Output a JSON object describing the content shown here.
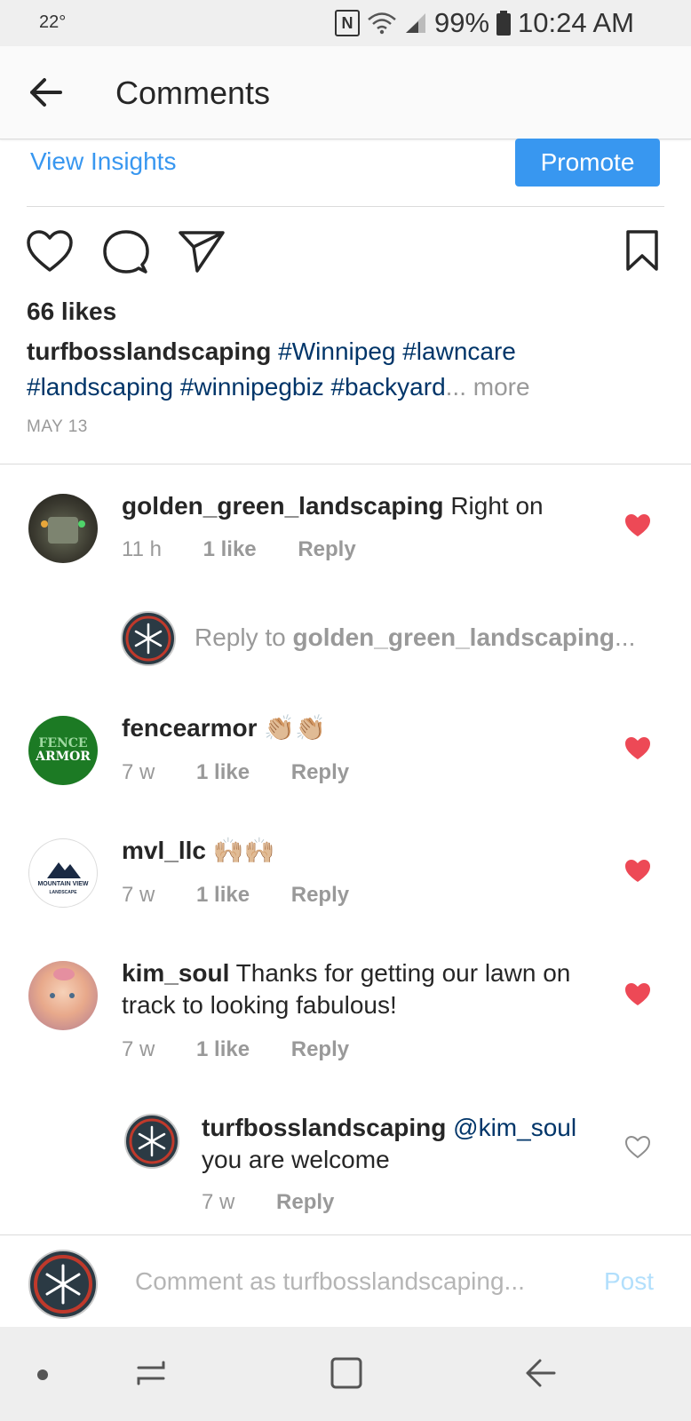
{
  "status_bar": {
    "temperature": "22°",
    "battery": "99%",
    "time": "10:24 AM"
  },
  "header": {
    "title": "Comments"
  },
  "post": {
    "view_insights": "View Insights",
    "promote": "Promote",
    "likes": "66 likes",
    "caption_user": "turfbosslandscaping",
    "caption_tags_line1": "#Winnipeg #lawncare",
    "caption_tags_line2": "#landscaping #winnipegbiz #backyard",
    "ellipsis": "...",
    "more": "more",
    "date": "MAY 13"
  },
  "comments": [
    {
      "user": "golden_green_landscaping",
      "text": "Right on",
      "time": "11 h",
      "likes": "1 like",
      "reply": "Reply",
      "liked": true
    },
    {
      "user": "fencearmor",
      "text": "👏🏼👏🏼",
      "time": "7 w",
      "likes": "1 like",
      "reply": "Reply",
      "liked": true
    },
    {
      "user": "mvl_llc",
      "text": "🙌🏼🙌🏼",
      "time": "7 w",
      "likes": "1 like",
      "reply": "Reply",
      "liked": true
    },
    {
      "user": "kim_soul",
      "text_line1": "Thanks for getting our lawn on",
      "text_line2": "track to looking fabulous!",
      "time": "7 w",
      "likes": "1 like",
      "reply": "Reply",
      "liked": true
    }
  ],
  "reply_prompt": {
    "prefix": "Reply to ",
    "user": "golden_green_landscaping",
    "suffix": "..."
  },
  "nested_reply": {
    "user": "turfbosslandscaping",
    "mention": "@kim_soul",
    "text": "you are welcome",
    "time": "7 w",
    "reply": "Reply",
    "liked": false
  },
  "avatars": {
    "fencearmor_line1": "FENCE",
    "fencearmor_line2": "ARMOR",
    "mvl_line1": "MOUNTAIN VIEW",
    "mvl_line2": "LANDSCAPE"
  },
  "comment_bar": {
    "placeholder": "Comment as turfbosslandscaping...",
    "post": "Post"
  },
  "colors": {
    "accent": "#3897f0",
    "heart": "#ed4956",
    "hashtag": "#003569"
  }
}
